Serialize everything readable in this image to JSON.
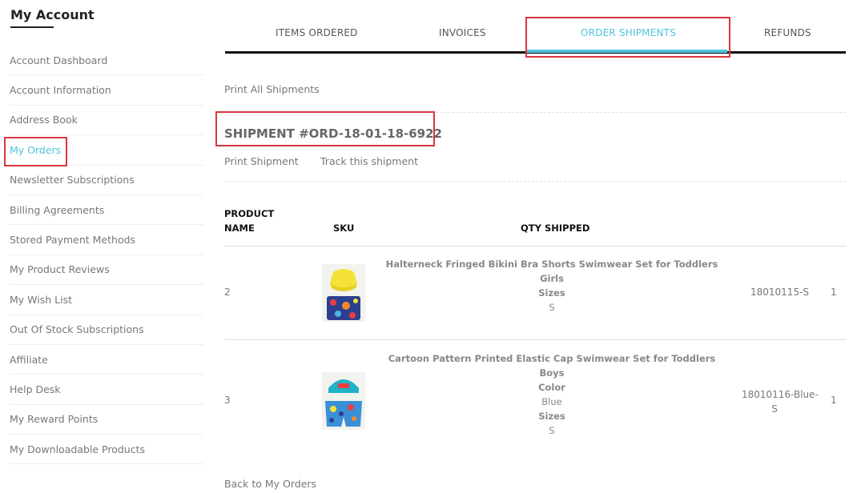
{
  "sidebar": {
    "title": "My Account",
    "items": [
      {
        "label": "Account Dashboard"
      },
      {
        "label": "Account Information"
      },
      {
        "label": "Address Book"
      },
      {
        "label": "My Orders"
      },
      {
        "label": "Newsletter Subscriptions"
      },
      {
        "label": "Billing Agreements"
      },
      {
        "label": "Stored Payment Methods"
      },
      {
        "label": "My Product Reviews"
      },
      {
        "label": "My Wish List"
      },
      {
        "label": "Out Of Stock Subscriptions"
      },
      {
        "label": "Affiliate"
      },
      {
        "label": "Help Desk"
      },
      {
        "label": "My Reward Points"
      },
      {
        "label": "My Downloadable Products"
      }
    ],
    "active_item": "My Orders"
  },
  "tabs": [
    {
      "label": "ITEMS ORDERED"
    },
    {
      "label": "INVOICES"
    },
    {
      "label": "ORDER SHIPMENTS"
    },
    {
      "label": "REFUNDS"
    }
  ],
  "active_tab": "ORDER SHIPMENTS",
  "print_all": "Print All Shipments",
  "shipment": {
    "title": "SHIPMENT #ORD-18-01-18-6922",
    "print_link": "Print Shipment",
    "track_link": "Track this shipment"
  },
  "table": {
    "headers": {
      "product_name_1": "PRODUCT",
      "product_name_2": "NAME",
      "sku": "SKU",
      "qty": "QTY SHIPPED"
    },
    "rows": [
      {
        "index": "2",
        "name": "Halterneck Fringed Bikini Bra Shorts Swimwear Set for Toddlers",
        "lines": [
          {
            "kind": "lbl",
            "text": "Girls"
          },
          {
            "kind": "lbl",
            "text": "Sizes"
          },
          {
            "kind": "val",
            "text": "S"
          }
        ],
        "sku": "18010115-S",
        "qty": "1"
      },
      {
        "index": "3",
        "name": "Cartoon Pattern Printed Elastic Cap Swimwear Set for Toddlers",
        "lines": [
          {
            "kind": "lbl",
            "text": "Boys"
          },
          {
            "kind": "lbl",
            "text": "Color"
          },
          {
            "kind": "val",
            "text": "Blue"
          },
          {
            "kind": "lbl",
            "text": "Sizes"
          },
          {
            "kind": "val",
            "text": "S"
          }
        ],
        "sku_1": "18010116-Blue-",
        "sku_2": "S",
        "qty": "1"
      }
    ]
  },
  "back_link": "Back to My Orders",
  "colors": {
    "accent": "#4fc3dc",
    "highlight": "#d9363e",
    "text": "#777777",
    "heading": "#222222"
  }
}
